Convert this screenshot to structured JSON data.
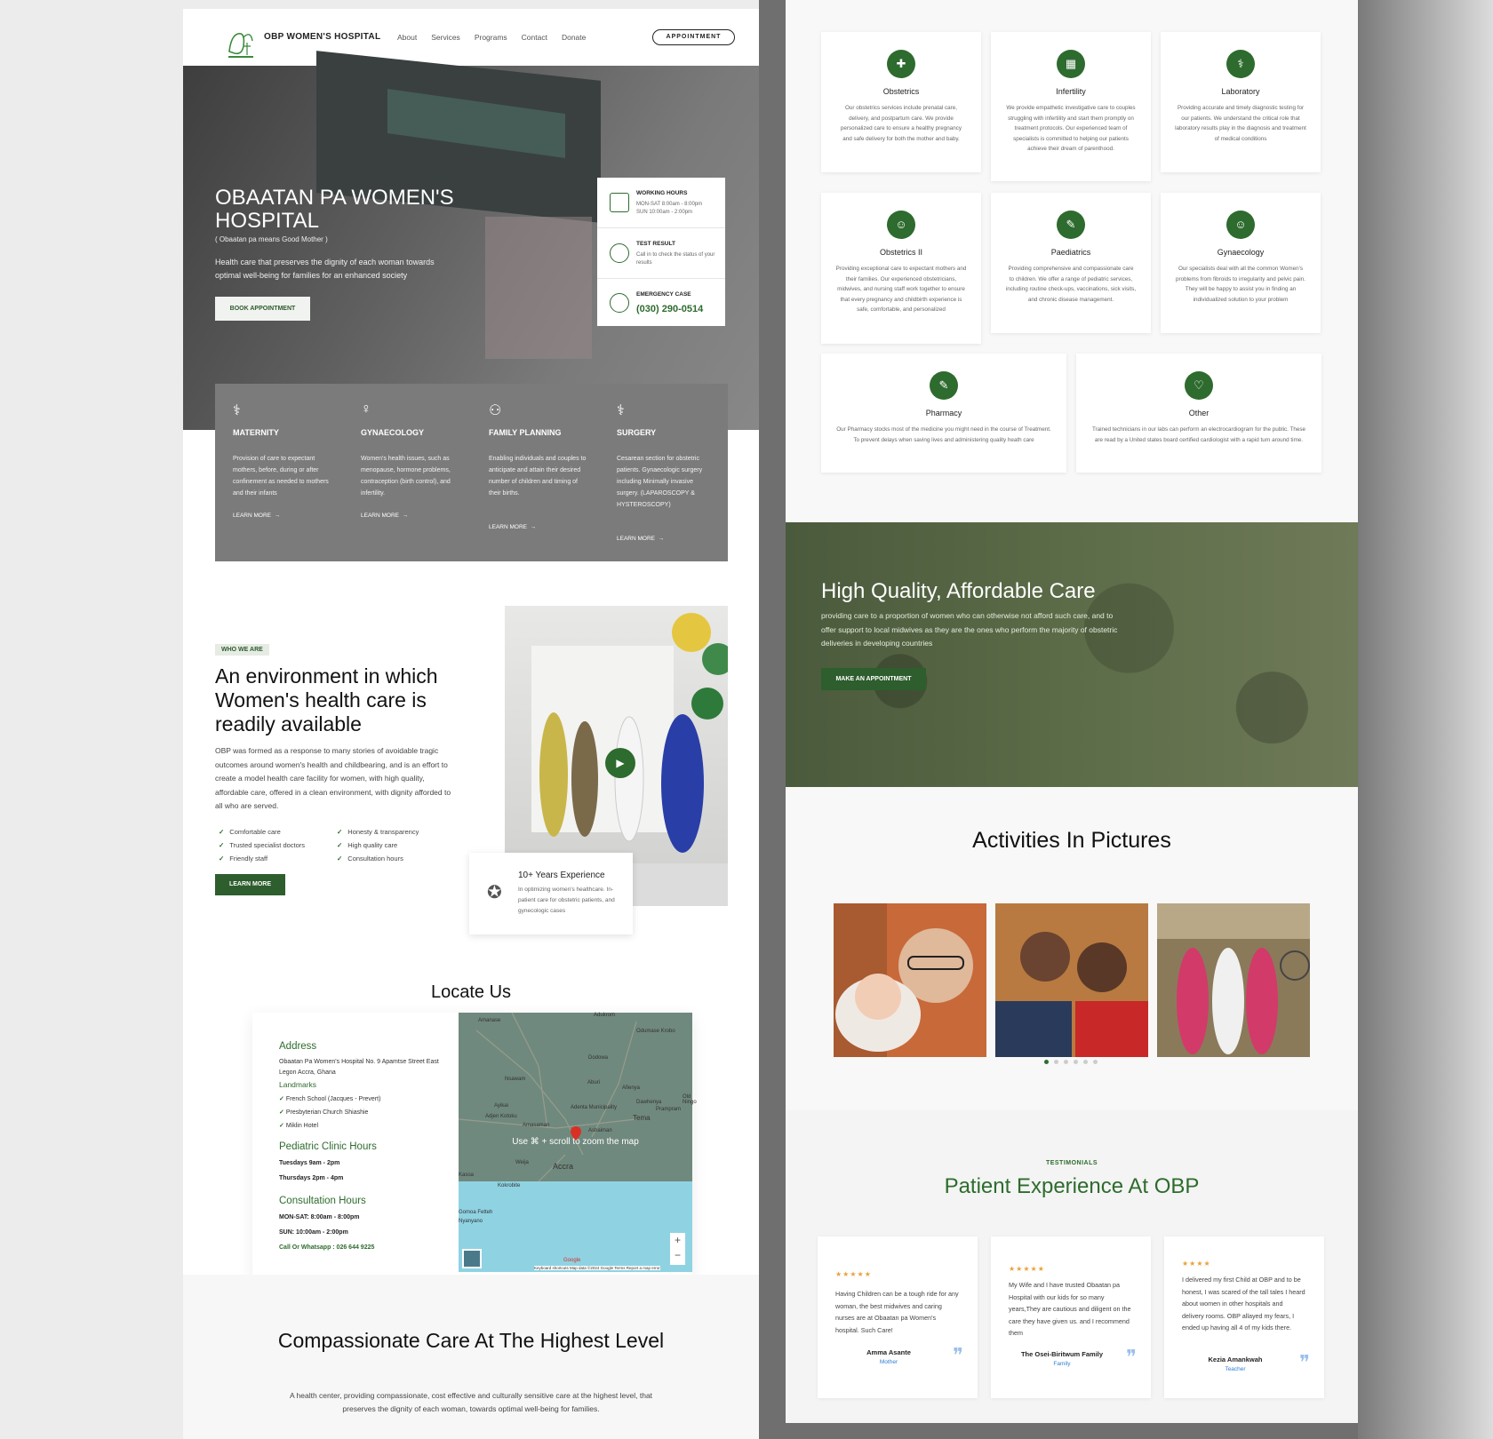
{
  "header": {
    "brand": "OBP WOMEN'S HOSPITAL",
    "nav": [
      "About",
      "Services",
      "Programs",
      "Contact",
      "Donate"
    ],
    "appointment_button": "APPOINTMENT"
  },
  "hero": {
    "title": "OBAATAN PA WOMEN'S HOSPITAL",
    "subtitle": "( Obaatan pa means Good Mother )",
    "description": "Health care that preserves the dignity of each woman towards optimal well-being for families for an enhanced society",
    "button": "BOOK APPOINTMENT",
    "info": {
      "hours_title": "WORKING HOURS",
      "hours_line1": "MON-SAT 8:00am - 8:00pm",
      "hours_line2": "SUN 10:00am - 2:00pm",
      "test_title": "TEST RESULT",
      "test_text": "Call in to check the status of your results",
      "emergency_title": "EMERGENCY CASE",
      "emergency_phone": "(030) 290-0514"
    }
  },
  "services": [
    {
      "icon": "maternity-icon",
      "title": "MATERNITY",
      "text": "Provision of care to expectant mothers, before, during or after confinement as needed to mothers and their infants",
      "link": "LEARN MORE"
    },
    {
      "icon": "gynaecology-icon",
      "title": "GYNAECOLOGY",
      "text": "Women's health issues, such as menopause, hormone problems, contraception (birth control), and infertility.",
      "link": "LEARN MORE"
    },
    {
      "icon": "family-planning-icon",
      "title": "FAMILY PLANNING",
      "text": "Enabling individuals and couples to anticipate and attain their desired number of children and timing of their births.",
      "link": "LEARN MORE"
    },
    {
      "icon": "surgery-icon",
      "title": "SURGERY",
      "text": "Cesarean section for obstetric patients. Gynaecologic surgery including Minimally invasive surgery. (LAPAROSCOPY & HYSTEROSCOPY)",
      "link": "LEARN MORE"
    }
  ],
  "about": {
    "tag": "WHO WE ARE",
    "title": "An environment in which Women's health care is readily available",
    "text": "OBP was formed as a response to many stories of avoidable tragic outcomes around women's health and childbearing, and is an effort to create a model health care facility for women, with high quality, affordable care, offered in a clean environment, with dignity afforded to all who are served.",
    "checks": [
      "Comfortable care",
      "Honesty & transparency",
      "Trusted specialist doctors",
      "High quality care",
      "Friendly staff",
      "Consultation hours"
    ],
    "button": "LEARN MORE",
    "experience_title": "10+ Years Experience",
    "experience_text": "In optimizing women's healthcare. In-patient care for obstetric patients, and gynecologic cases"
  },
  "locate": {
    "title": "Locate Us",
    "address_title": "Address",
    "address": "Obaatan Pa Women's Hospital No. 9 Apamtse Street East Legon Accra, Ghana",
    "landmarks_title": "Landmarks",
    "landmarks": [
      "French School (Jacques - Prevert)",
      "Presbyterian Church Shiashie",
      "Miklin Hotel"
    ],
    "pediatric_title": "Pediatric Clinic Hours",
    "pediatric_1": "Tuesdays 9am - 2pm",
    "pediatric_2": "Thursdays 2pm - 4pm",
    "consult_title": "Consultation Hours",
    "consult_1": "MON-SAT: 8:00am - 8:00pm",
    "consult_2": "SUN: 10:00am - 2:00pm",
    "whatsapp": "Call Or Whatsapp : 026 644 9225",
    "map_tip": "Use ⌘ + scroll to zoom the map",
    "map_towns": [
      "Amanase",
      "Adukrom",
      "Odumase Krobo",
      "Nsawam",
      "Dodowa",
      "Ayikai",
      "Aburi",
      "Afienya",
      "Dawhenya",
      "Adjen Kotoku",
      "Adenta Municipality",
      "Tema",
      "Prampram",
      "Amasaman",
      "Ashaiman",
      "Kasoa",
      "Weija",
      "Accra",
      "Kokrobite",
      "Gomoa Fetteh",
      "Nyanyano",
      "Old Ningo"
    ],
    "map_attr": "Keyboard shortcuts   Map data ©2024 Google   Terms   Report a map error",
    "google": "Google"
  },
  "compassion": {
    "title": "Compassionate Care At The Highest Level",
    "text": "A health center, providing compassionate, cost effective and culturally sensitive care at the highest level, that preserves the dignity of each woman, towards optimal well-being for families."
  },
  "departments": [
    {
      "icon": "obstetrics-icon",
      "title": "Obstetrics",
      "text": "Our obstetrics services include prenatal care, delivery, and postpartum care. We provide personalized care to ensure a healthy pregnancy and safe delivery for both the mother and baby."
    },
    {
      "icon": "infertility-icon",
      "title": "Infertility",
      "text": "We provide empathetic investigative care to couples struggling with infertility and start them promptly on treatment protocols. Our experienced team of specialists is committed to helping our patients achieve their dream of parenthood."
    },
    {
      "icon": "laboratory-icon",
      "title": "Laboratory",
      "text": "Providing accurate and timely diagnostic testing for our patients. We understand the critical role that laboratory results play in the diagnosis and treatment of medical conditions"
    },
    {
      "icon": "obstetrics-ii-icon",
      "title": "Obstetrics II",
      "text": "Providing exceptional care to expectant mothers and their families. Our experienced obstetricians, midwives, and nursing staff work together to ensure that every pregnancy and childbirth experience is safe, comfortable, and personalized"
    },
    {
      "icon": "paediatrics-icon",
      "title": "Paediatrics",
      "text": "Providing comprehensive and compassionate care to children. We offer a range of pediatric services, including routine check-ups, vaccinations, sick visits, and chronic disease management."
    },
    {
      "icon": "gynaecology-dept-icon",
      "title": "Gynaecology",
      "text": "Our specialists deal with all the common Women's problems from fibroids to irregularity and pelvic pain. They will be happy to assist you in finding an individualized solution to your problem"
    },
    {
      "icon": "pharmacy-icon",
      "title": "Pharmacy",
      "text": "Our Pharmacy stocks most of the medicine you might need in the course of Treatment. To prevent delays when saving lives and administering quality heath care"
    },
    {
      "icon": "heart-icon",
      "title": "Other",
      "text": "Trained technicians in our labs can perform an electrocardiogram for the public. These are read by a United states board certified cardiologist with a rapid turn around time."
    }
  ],
  "quality": {
    "title": "High Quality, Affordable Care",
    "text": "providing care to a proportion of women who can otherwise not afford such care, and to offer support to local midwives as they are the ones who perform the majority of obstetric deliveries in developing countries",
    "button": "MAKE AN APPOINTMENT"
  },
  "activities": {
    "title": "Activities In Pictures",
    "dots": 6,
    "active_dot": 0
  },
  "testimonials": {
    "tag": "TESTIMONIALS",
    "title": "Patient Experience At OBP",
    "items": [
      {
        "stars": "★★★★★",
        "text": "Having Children can be a tough ride for any woman, the best midwives and caring nurses are at Obaatan pa Women's hospital. Such Care!",
        "name": "Amma Asante",
        "role": "Mother"
      },
      {
        "stars": "★★★★★",
        "text": "My Wife and I have trusted Obaatan pa Hospital with our kids for so many years,They are cautious and diligent on the care they have given us. and I recommend them",
        "name": "The Osei-Biritwum Family",
        "role": "Family"
      },
      {
        "stars": "★★★★",
        "text": "I delivered my first Child at OBP and to be honest, I was scared of the tall tales I heard about women in other hospitals and delivery rooms. OBP allayed my fears, I ended up having all 4 of my kids there.",
        "name": "Kezia Amankwah",
        "role": "Teacher"
      }
    ]
  },
  "colors": {
    "brand_green": "#2e6b2e",
    "star": "#e8a23a",
    "role_blue": "#2e7fd1"
  }
}
